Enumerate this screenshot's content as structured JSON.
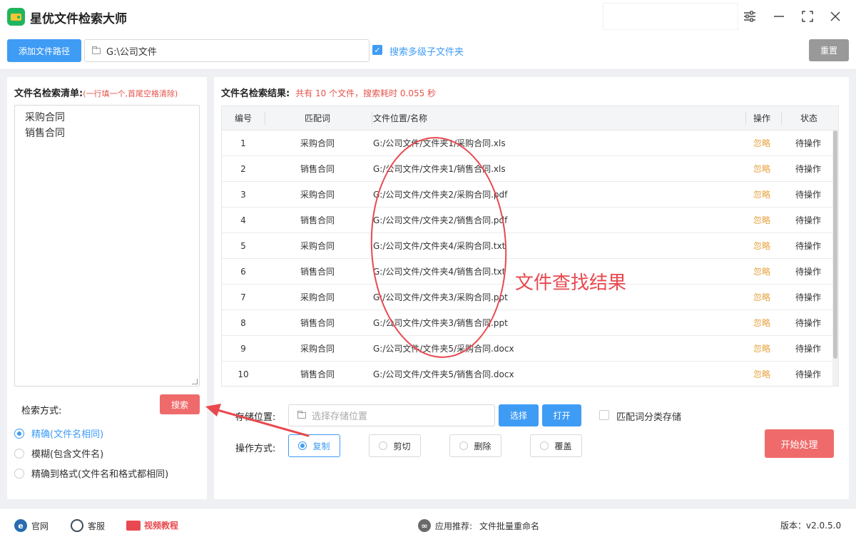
{
  "app": {
    "title": "星优文件检索大师"
  },
  "toolbar": {
    "add_path_label": "添加文件路径",
    "path_value": "G:\\公司文件",
    "subfolder_label": "搜索多级子文件夹",
    "subfolder_checked": true,
    "reset_label": "重置"
  },
  "left": {
    "list_title": "文件名检索清单:",
    "list_hint": "(一行填一个,首尾空格清除)",
    "terms": [
      "采购合同",
      "销售合同"
    ],
    "search_button": "搜索",
    "method_label": "检索方式:",
    "methods": [
      {
        "label": "精确(文件名相同)",
        "selected": true
      },
      {
        "label": "模糊(包含文件名)",
        "selected": false
      },
      {
        "label": "精确到格式(文件名和格式都相同)",
        "selected": false
      }
    ]
  },
  "right": {
    "result_title": "文件名检索结果:",
    "result_summary": "共有 10 个文件，搜索耗时 0.055 秒",
    "columns": [
      "编号",
      "匹配词",
      "文件位置/名称",
      "操作",
      "状态"
    ],
    "rows": [
      {
        "no": "1",
        "term": "采购合同",
        "path": "G:/公司文件/文件夹1/采购合同.xls",
        "op": "忽略",
        "status": "待操作"
      },
      {
        "no": "2",
        "term": "销售合同",
        "path": "G:/公司文件/文件夹1/销售合同.xls",
        "op": "忽略",
        "status": "待操作"
      },
      {
        "no": "3",
        "term": "采购合同",
        "path": "G:/公司文件/文件夹2/采购合同.pdf",
        "op": "忽略",
        "status": "待操作"
      },
      {
        "no": "4",
        "term": "销售合同",
        "path": "G:/公司文件/文件夹2/销售合同.pdf",
        "op": "忽略",
        "status": "待操作"
      },
      {
        "no": "5",
        "term": "采购合同",
        "path": "G:/公司文件/文件夹4/采购合同.txt",
        "op": "忽略",
        "status": "待操作"
      },
      {
        "no": "6",
        "term": "销售合同",
        "path": "G:/公司文件/文件夹4/销售合同.txt",
        "op": "忽略",
        "status": "待操作"
      },
      {
        "no": "7",
        "term": "采购合同",
        "path": "G:/公司文件/文件夹3/采购合同.ppt",
        "op": "忽略",
        "status": "待操作"
      },
      {
        "no": "8",
        "term": "销售合同",
        "path": "G:/公司文件/文件夹3/销售合同.ppt",
        "op": "忽略",
        "status": "待操作"
      },
      {
        "no": "9",
        "term": "采购合同",
        "path": "G:/公司文件/文件夹5/采购合同.docx",
        "op": "忽略",
        "status": "待操作"
      },
      {
        "no": "10",
        "term": "销售合同",
        "path": "G:/公司文件/文件夹5/销售合同.docx",
        "op": "忽略",
        "status": "待操作"
      }
    ],
    "annotation": "文件查找结果",
    "storage_label": "存储位置:",
    "storage_placeholder": "选择存储位置",
    "choose_button": "选择",
    "open_button": "打开",
    "classify_label": "匹配词分类存储",
    "op_label": "操作方式:",
    "ops": [
      {
        "label": "复制",
        "selected": true
      },
      {
        "label": "剪切",
        "selected": false
      },
      {
        "label": "删除",
        "selected": false
      },
      {
        "label": "覆盖",
        "selected": false
      }
    ],
    "start_button": "开始处理"
  },
  "footer": {
    "website": "官网",
    "service": "客服",
    "video": "视频教程",
    "recommend_label": "应用推荐:",
    "recommend_app": "文件批量重命名",
    "version": "版本：v2.0.5.0"
  },
  "colors": {
    "accent": "#3f9cf5",
    "danger": "#ef6b6b",
    "warn": "#e6a23c",
    "brand": "#1fb55e"
  }
}
